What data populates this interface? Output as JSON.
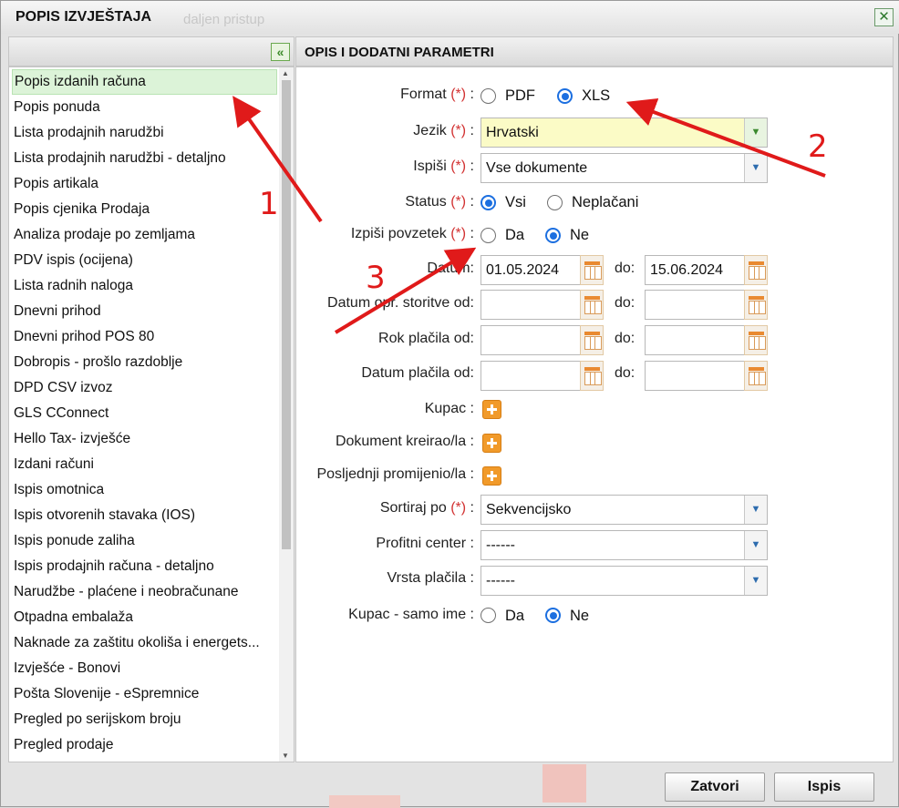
{
  "dialog": {
    "title": "POPIS IZVJEŠTAJA",
    "ghost_text": "daljen pristup"
  },
  "left_panel": {
    "collapse_icon": "double-chevron-left-icon",
    "items": [
      "Popis izdanih računa",
      "Popis ponuda",
      "Lista prodajnih narudžbi",
      "Lista prodajnih narudžbi - detaljno",
      "Popis artikala",
      "Popis cjenika Prodaja",
      "Analiza prodaje po zemljama",
      "PDV ispis (ocijena)",
      "Lista radnih naloga",
      "Dnevni prihod",
      "Dnevni prihod POS 80",
      "Dobropis - prošlo razdoblje",
      "DPD CSV izvoz",
      "GLS CConnect",
      "Hello Tax- izvješće",
      "Izdani računi",
      "Ispis omotnica",
      "Ispis otvorenih stavaka (IOS)",
      "Ispis ponude zaliha",
      "Ispis prodajnih računa - detaljno",
      "Narudžbe - plaćene i neobračunane",
      "Otpadna embalaža",
      "Naknade za zaštitu okoliša i energets...",
      "Izvješće - Bonovi",
      "Pošta Slovenije - eSpremnice",
      "Pregled po serijskom broju",
      "Pregled prodaje"
    ],
    "selected_index": 0
  },
  "right_panel": {
    "header": "OPIS I DODATNI PARAMETRI",
    "required_marker": "(*)",
    "format": {
      "label": "Format",
      "colon": ":",
      "options": [
        "PDF",
        "XLS"
      ],
      "selected": "XLS"
    },
    "jezik": {
      "label": "Jezik",
      "colon": ":",
      "value": "Hrvatski"
    },
    "ispisi": {
      "label": "Ispiši",
      "colon": ":",
      "value": "Vse dokumente"
    },
    "status": {
      "label": "Status",
      "colon": ":",
      "options": [
        "Vsi",
        "Neplačani"
      ],
      "selected": "Vsi"
    },
    "povzetek": {
      "label": "Izpiši povzetek",
      "colon": ":",
      "options": [
        "Da",
        "Ne"
      ],
      "selected": "Ne"
    },
    "datum": {
      "label": "Datum:",
      "from": "01.05.2024",
      "to_label": "do:",
      "to": "15.06.2024"
    },
    "datum_opr": {
      "label": "Datum opr. storitve od:",
      "to_label": "do:"
    },
    "rok_placila": {
      "label": "Rok plačila od:",
      "to_label": "do:"
    },
    "datum_placila": {
      "label": "Datum plačila od:",
      "to_label": "do:"
    },
    "kupac": {
      "label": "Kupac :"
    },
    "dokument_kreirao": {
      "label": "Dokument kreirao/la :"
    },
    "posljednji": {
      "label": "Posljednji promijenio/la :"
    },
    "sortiraj": {
      "label": "Sortiraj po",
      "colon": ":",
      "value": "Sekvencijsko"
    },
    "profitni": {
      "label": "Profitni center :",
      "value": "------"
    },
    "vrsta_placila": {
      "label": "Vrsta plačila :",
      "value": "------"
    },
    "kupac_ime": {
      "label": "Kupac - samo ime :",
      "options": [
        "Da",
        "Ne"
      ],
      "selected": "Ne"
    }
  },
  "footer": {
    "close_label": "Zatvori",
    "print_label": "Ispis"
  },
  "annotations": {
    "labels": [
      "1",
      "2",
      "3"
    ],
    "color": "#e01a1a"
  }
}
